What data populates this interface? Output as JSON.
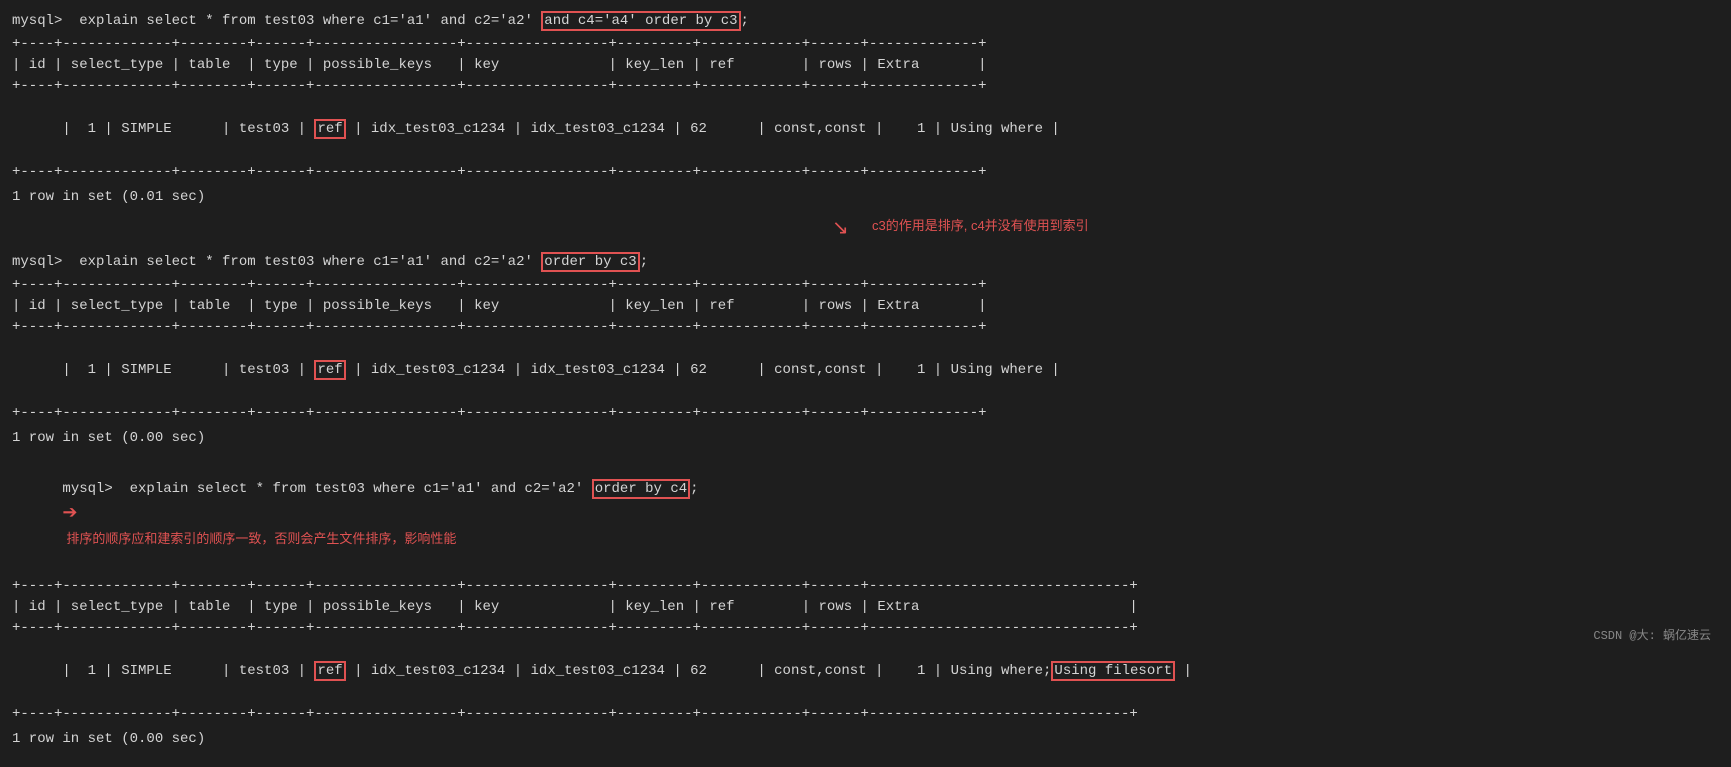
{
  "terminal": {
    "background": "#1e1e1e",
    "text_color": "#d4d4d4",
    "red_border": "#e05252"
  },
  "section1": {
    "prompt": "mysql>  explain select * from test03 where c1='a1' and c2='a2' ",
    "highlight": "and c4='a4' order by c3",
    "prompt_end": ";",
    "separator": "+----+-------------+--------+------+---------------+---------------+---------+------------+------+-------------+",
    "header": "| id | select_type | table  | type | possible_keys             | key                       | key_len | ref               | rows | Extra       |",
    "data_prefix": "| 1  | SIMPLE      | test03 |",
    "data_type": "ref",
    "data_middle": "| idx_test03_c1234 | idx_test03_c1234 | 62      | const,const |",
    "data_suffix": " 1 | Using where |",
    "result": "1 row in set (0.01 sec)",
    "annotation": "c3的作用是排序, c4并没有使用到索引"
  },
  "section2": {
    "prompt": "mysql>  explain select * from test03 where c1='a1' and c2='a2' ",
    "highlight": "order by c3",
    "prompt_end": ";",
    "result": "1 row in set (0.00 sec)",
    "extra": "Using where"
  },
  "section3": {
    "prompt": "mysql>  explain select * from test03 where c1='a1' and c2='a2' ",
    "highlight": "order by c4",
    "annotation": "排序的顺序应和建索引的顺序一致，否则会产生文件排序，影响性能",
    "result": "1 row in set (0.00 sec)",
    "extra1": "Using where;",
    "extra2": "Using filesort"
  },
  "footer": {
    "text": "CSDN @大: 蜗亿速云"
  }
}
